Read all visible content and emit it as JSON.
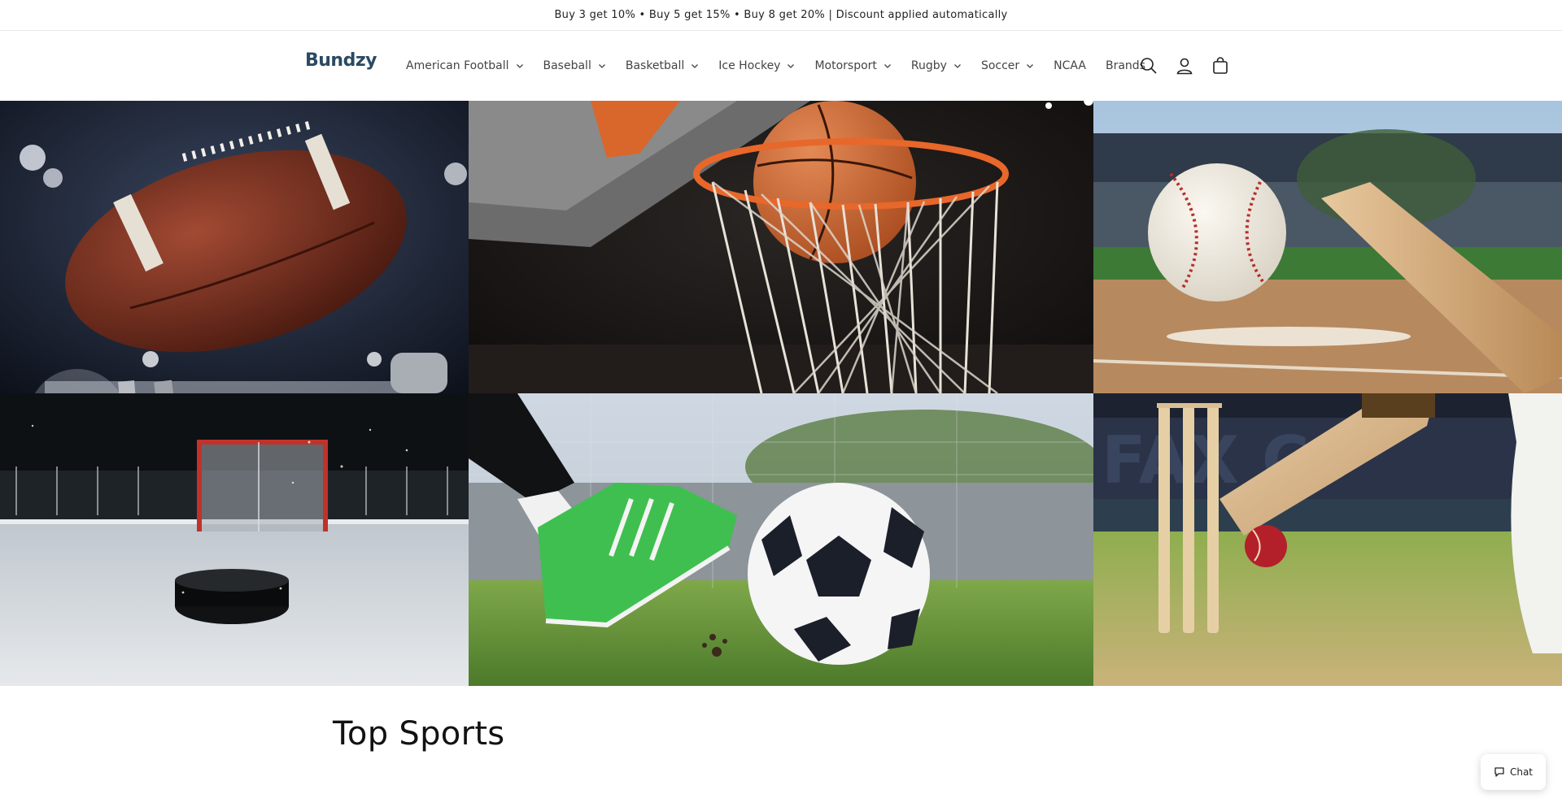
{
  "announcement": "Buy 3 get 10% • Buy 5 get 15% • Buy 8 get 20% | Discount applied automatically",
  "header": {
    "logo": "Bundzy",
    "nav": [
      {
        "label": "American Football",
        "dropdown": true
      },
      {
        "label": "Baseball",
        "dropdown": true
      },
      {
        "label": "Basketball",
        "dropdown": true
      },
      {
        "label": "Ice Hockey",
        "dropdown": true
      },
      {
        "label": "Motorsport",
        "dropdown": true
      },
      {
        "label": "Rugby",
        "dropdown": true
      },
      {
        "label": "Soccer",
        "dropdown": true
      },
      {
        "label": "NCAA",
        "dropdown": false
      },
      {
        "label": "Brands",
        "dropdown": false
      }
    ],
    "icons": [
      "search-icon",
      "account-icon",
      "cart-icon"
    ]
  },
  "hero_tiles": [
    {
      "sport": "american-football"
    },
    {
      "sport": "basketball"
    },
    {
      "sport": "baseball"
    },
    {
      "sport": "ice-hockey"
    },
    {
      "sport": "soccer"
    },
    {
      "sport": "cricket"
    }
  ],
  "section": {
    "title": "Top Sports"
  },
  "chat": {
    "label": "Chat",
    "icon": "chat-icon"
  },
  "colors": {
    "brand": "#2b4a63",
    "text": "#121212"
  }
}
